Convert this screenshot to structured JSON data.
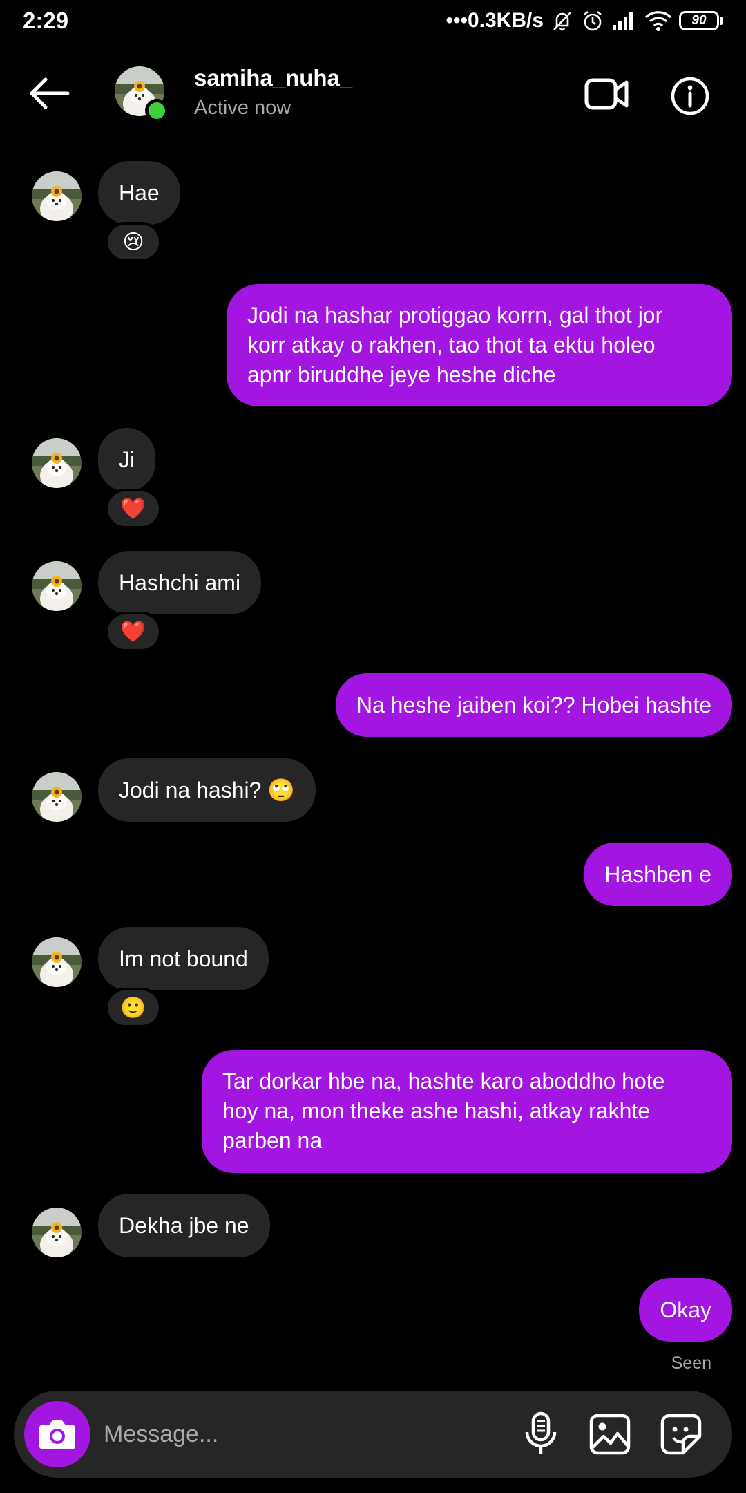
{
  "status_bar": {
    "time": "2:29",
    "network_speed": "•••0.3KB/s",
    "battery": "90"
  },
  "header": {
    "username": "samiha_nuha_",
    "presence": "Active now"
  },
  "messages": [
    {
      "sender": "them",
      "text": "Hae",
      "reaction": "😢"
    },
    {
      "sender": "me",
      "lines": [
        "Jodi na hashar protiggao korrn, gal thot jor",
        "korr  atkay o rakhen, tao thot ta ektu holeo",
        "apnr biruddhe jeye heshe diche"
      ]
    },
    {
      "sender": "them",
      "text": "Ji",
      "reaction": "❤️"
    },
    {
      "sender": "them",
      "text": "Hashchi ami",
      "reaction": "❤️"
    },
    {
      "sender": "me",
      "text": "Na heshe jaiben koi?? Hobei hashte"
    },
    {
      "sender": "them",
      "text": "Jodi na hashi? 🙄"
    },
    {
      "sender": "me",
      "text": "Hashben e"
    },
    {
      "sender": "them",
      "text": "Im not bound",
      "reaction": "🙂"
    },
    {
      "sender": "me",
      "lines": [
        "Tar dorkar hbe na, hashte karo aboddho hote",
        "hoy na, mon theke ashe hashi, atkay rakhte",
        "parben na"
      ]
    },
    {
      "sender": "them",
      "text": "Dekha jbe ne"
    },
    {
      "sender": "me",
      "text": "Okay"
    }
  ],
  "seen_label": "Seen",
  "composer": {
    "placeholder": "Message..."
  },
  "colors": {
    "outgoing_bubble": "#a315e0",
    "incoming_bubble": "#262626",
    "online": "#3dd13d"
  }
}
